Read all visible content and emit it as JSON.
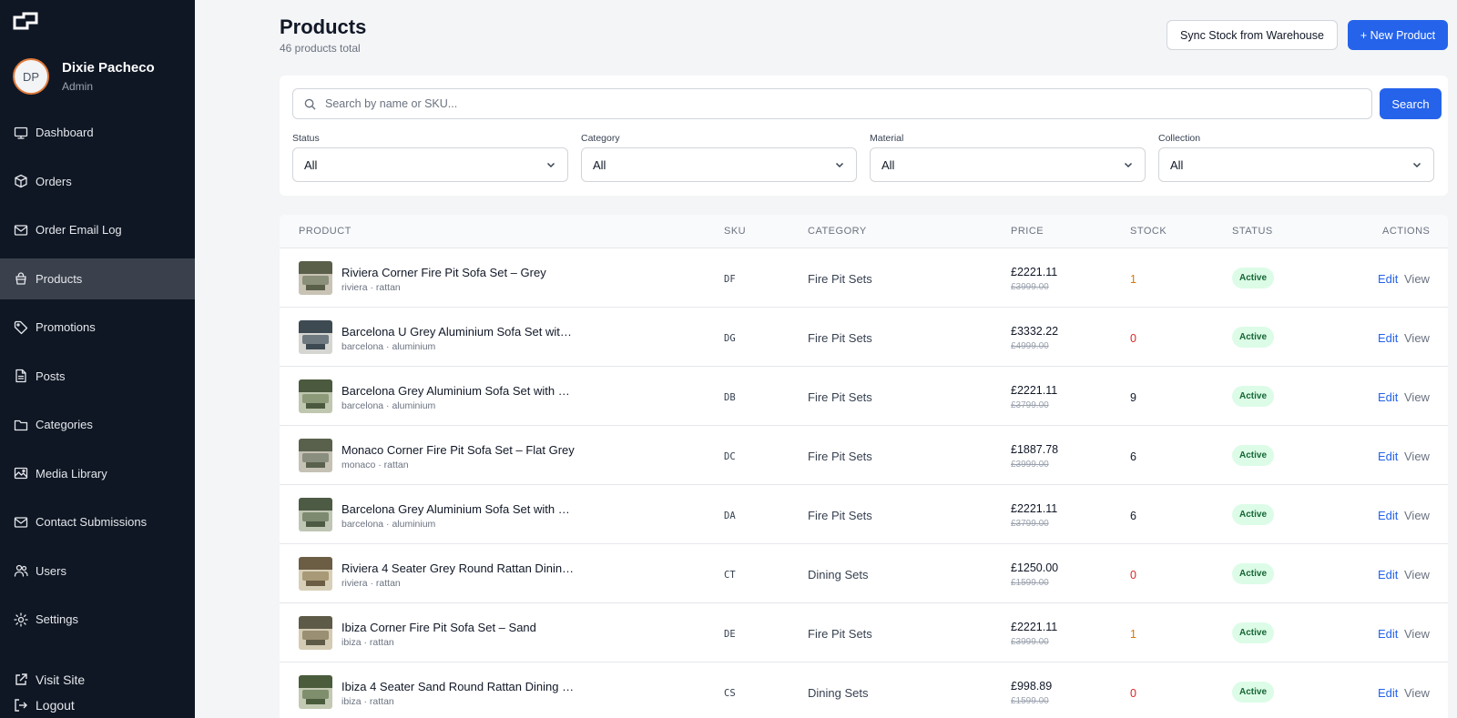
{
  "sidebar": {
    "user_initials": "DP",
    "user_name": "Dixie Pacheco",
    "user_role": "Admin",
    "items": [
      {
        "label": "Dashboard",
        "icon": "monitor-icon"
      },
      {
        "label": "Orders",
        "icon": "box-icon"
      },
      {
        "label": "Order Email Log",
        "icon": "mail-icon"
      },
      {
        "label": "Products",
        "icon": "bag-icon",
        "active": true
      },
      {
        "label": "Promotions",
        "icon": "tag-icon"
      },
      {
        "label": "Posts",
        "icon": "document-icon"
      },
      {
        "label": "Categories",
        "icon": "folder-icon"
      },
      {
        "label": "Media Library",
        "icon": "image-icon"
      },
      {
        "label": "Contact Submissions",
        "icon": "mail-icon"
      },
      {
        "label": "Users",
        "icon": "users-icon"
      },
      {
        "label": "Settings",
        "icon": "gear-icon"
      }
    ],
    "visit_site": "Visit Site",
    "logout": "Logout"
  },
  "header": {
    "title": "Products",
    "subtitle": "46 products total",
    "sync_label": "Sync Stock from Warehouse",
    "new_label": "+ New Product"
  },
  "filters": {
    "search_placeholder": "Search by name or SKU...",
    "search_value": "",
    "search_button": "Search",
    "status_label": "Status",
    "status_value": "All",
    "category_label": "Category",
    "category_value": "All",
    "material_label": "Material",
    "material_value": "All",
    "collection_label": "Collection",
    "collection_value": "All"
  },
  "table": {
    "columns": [
      "PRODUCT",
      "SKU",
      "CATEGORY",
      "PRICE",
      "STOCK",
      "STATUS",
      "ACTIONS"
    ],
    "edit_label": "Edit",
    "view_label": "View",
    "rows": [
      {
        "name": "Riviera Corner Fire Pit Sofa Set – Grey",
        "meta": "riviera · rattan",
        "sku": "DF",
        "category": "Fire Pit Sets",
        "price": "£2221.11",
        "old_price": "£3999.00",
        "stock": "1",
        "stock_level": "low",
        "status": "Active"
      },
      {
        "name": "Barcelona U Grey Aluminium Sofa Set wit…",
        "meta": "barcelona · aluminium",
        "sku": "DG",
        "category": "Fire Pit Sets",
        "price": "£3332.22",
        "old_price": "£4999.00",
        "stock": "0",
        "stock_level": "zero",
        "status": "Active"
      },
      {
        "name": "Barcelona Grey Aluminium Sofa Set with …",
        "meta": "barcelona · aluminium",
        "sku": "DB",
        "category": "Fire Pit Sets",
        "price": "£2221.11",
        "old_price": "£3799.00",
        "stock": "9",
        "stock_level": "ok",
        "status": "Active"
      },
      {
        "name": "Monaco Corner Fire Pit Sofa Set – Flat Grey",
        "meta": "monaco · rattan",
        "sku": "DC",
        "category": "Fire Pit Sets",
        "price": "£1887.78",
        "old_price": "£3999.00",
        "stock": "6",
        "stock_level": "ok",
        "status": "Active"
      },
      {
        "name": "Barcelona Grey Aluminium Sofa Set with …",
        "meta": "barcelona · aluminium",
        "sku": "DA",
        "category": "Fire Pit Sets",
        "price": "£2221.11",
        "old_price": "£3799.00",
        "stock": "6",
        "stock_level": "ok",
        "status": "Active"
      },
      {
        "name": "Riviera 4 Seater Grey Round Rattan Dinin…",
        "meta": "riviera · rattan",
        "sku": "CT",
        "category": "Dining Sets",
        "price": "£1250.00",
        "old_price": "£1599.00",
        "stock": "0",
        "stock_level": "zero",
        "status": "Active"
      },
      {
        "name": "Ibiza Corner Fire Pit Sofa Set – Sand",
        "meta": "ibiza · rattan",
        "sku": "DE",
        "category": "Fire Pit Sets",
        "price": "£2221.11",
        "old_price": "£3999.00",
        "stock": "1",
        "stock_level": "low",
        "status": "Active"
      },
      {
        "name": "Ibiza 4 Seater Sand Round Rattan Dining …",
        "meta": "ibiza · rattan",
        "sku": "CS",
        "category": "Dining Sets",
        "price": "£998.89",
        "old_price": "£1599.00",
        "stock": "0",
        "stock_level": "zero",
        "status": "Active"
      }
    ]
  },
  "colors": {
    "sidebar_bg": "#0f1724",
    "accent": "#2563eb",
    "active_badge_bg": "#dcfce7",
    "stock_low": "#d97706",
    "stock_zero": "#dc2626"
  }
}
